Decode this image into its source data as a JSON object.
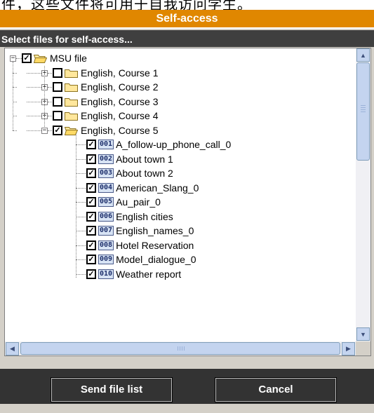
{
  "top_strip_text": "件，这些文件将可用于自我访问学生。",
  "window": {
    "title": "Self-access",
    "subtitle": "Select files for self-access..."
  },
  "tree": {
    "root": {
      "label": "MSU file",
      "expander": "−",
      "checked": true,
      "check_mark": "✓"
    },
    "courses": [
      {
        "label": "English, Course 1",
        "expander": "+",
        "checked": false,
        "check_mark": ""
      },
      {
        "label": "English, Course 2",
        "expander": "+",
        "checked": false,
        "check_mark": ""
      },
      {
        "label": "English, Course 3",
        "expander": "+",
        "checked": false,
        "check_mark": ""
      },
      {
        "label": "English, Course 4",
        "expander": "+",
        "checked": false,
        "check_mark": ""
      },
      {
        "label": "English, Course 5",
        "expander": "−",
        "checked": true,
        "check_mark": "✓"
      }
    ],
    "files": [
      {
        "num": "001",
        "label": "A_follow-up_phone_call_0",
        "check_mark": "✓"
      },
      {
        "num": "002",
        "label": "About town 1",
        "check_mark": "✓"
      },
      {
        "num": "003",
        "label": "About town 2",
        "check_mark": "✓"
      },
      {
        "num": "004",
        "label": "American_Slang_0",
        "check_mark": "✓"
      },
      {
        "num": "005",
        "label": "Au_pair_0",
        "check_mark": "✓"
      },
      {
        "num": "006",
        "label": "English cities",
        "check_mark": "✓"
      },
      {
        "num": "007",
        "label": "English_names_0",
        "check_mark": "✓"
      },
      {
        "num": "008",
        "label": "Hotel Reservation",
        "check_mark": "✓"
      },
      {
        "num": "009",
        "label": "Model_dialogue_0",
        "check_mark": "✓"
      },
      {
        "num": "010",
        "label": "Weather report",
        "check_mark": "✓"
      }
    ]
  },
  "scrollbars": {
    "up_arrow": "▲",
    "down_arrow": "▼",
    "left_arrow": "◀",
    "right_arrow": "▶"
  },
  "buttons": {
    "send": "Send file list",
    "cancel": "Cancel"
  },
  "colors": {
    "title_bar": "#e08700",
    "subtitle_bar": "#3f3f3f",
    "bottom_bar": "#333333",
    "scrollbar": "#c4d4ef"
  },
  "icons": {
    "expander": "expander-icon",
    "checkbox": "checkbox-icon",
    "folder_closed": "folder-closed-icon",
    "folder_open": "folder-open-icon",
    "file": "numbered-file-icon"
  }
}
